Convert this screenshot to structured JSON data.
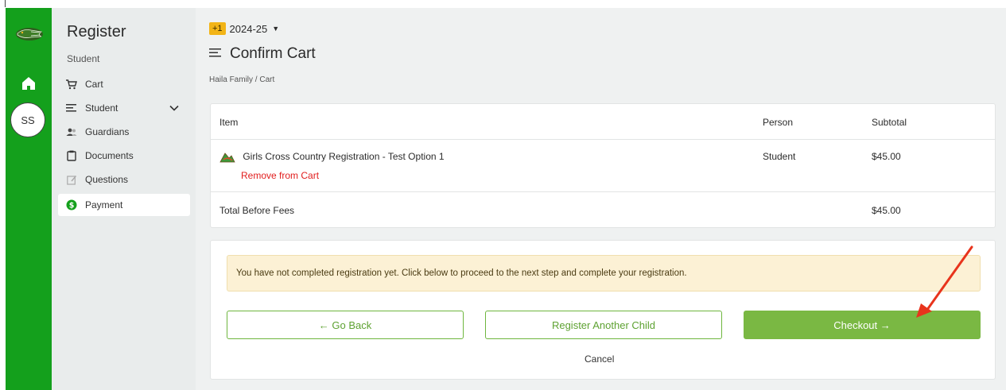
{
  "rail": {
    "avatar_initials": "SS",
    "icons": [
      "gator-logo-icon",
      "home-icon"
    ],
    "color": "#14a01c"
  },
  "sidebar": {
    "title": "Register",
    "subtitle": "Student",
    "items": [
      {
        "label": "Cart",
        "icon": "cart-icon"
      },
      {
        "label": "Student",
        "icon": "list-icon",
        "expandable": true
      },
      {
        "label": "Guardians",
        "icon": "people-icon"
      },
      {
        "label": "Documents",
        "icon": "clipboard-icon"
      },
      {
        "label": "Questions",
        "icon": "edit-note-icon"
      },
      {
        "label": "Payment",
        "icon": "dollar-icon",
        "active": true
      }
    ]
  },
  "header": {
    "season_badge": "+1",
    "season": "2024-25",
    "title": "Confirm Cart",
    "breadcrumb": "Haila Family / Cart"
  },
  "cart": {
    "columns": {
      "item": "Item",
      "person": "Person",
      "subtotal": "Subtotal"
    },
    "rows": [
      {
        "item": "Girls Cross Country Registration - Test Option 1",
        "remove": "Remove from Cart",
        "person": "Student",
        "subtotal": "$45.00"
      }
    ],
    "total_label": "Total Before Fees",
    "total_value": "$45.00"
  },
  "actions": {
    "alert": "You have not completed registration yet. Click below to proceed to the next step and complete your registration.",
    "go_back": "← Go Back",
    "register_another": "Register Another Child",
    "checkout": "Checkout →",
    "cancel": "Cancel"
  },
  "colors": {
    "brand_green": "#14a01c",
    "button_green": "#7ab843",
    "alert_bg": "#fcf1d5",
    "remove_red": "#e11d1d",
    "annotation_arrow": "#e8341c"
  }
}
